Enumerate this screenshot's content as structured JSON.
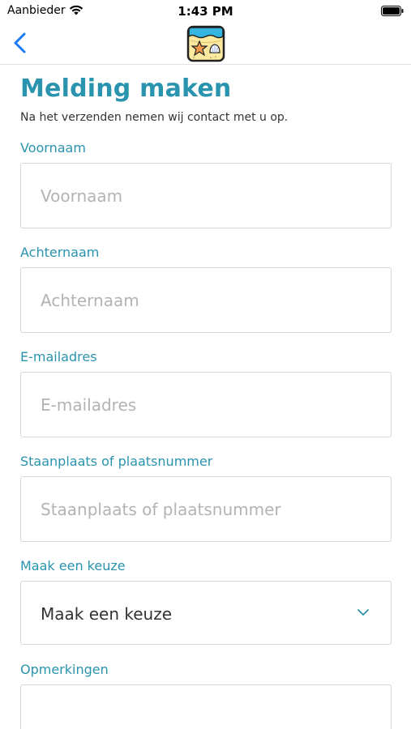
{
  "status_bar": {
    "carrier": "Aanbieder",
    "time": "1:43 PM"
  },
  "nav": {
    "back_icon": "chevron-left-icon",
    "logo_icon": "beach-logo-icon"
  },
  "page": {
    "title": "Melding maken",
    "subtitle": "Na het verzenden nemen wij contact met u op."
  },
  "form": {
    "first_name": {
      "label": "Voornaam",
      "placeholder": "Voornaam",
      "value": ""
    },
    "last_name": {
      "label": "Achternaam",
      "placeholder": "Achternaam",
      "value": ""
    },
    "email": {
      "label": "E-mailadres",
      "placeholder": "E-mailadres",
      "value": ""
    },
    "pitch": {
      "label": "Staanplaats of plaatsnummer",
      "placeholder": "Staanplaats of plaatsnummer",
      "value": ""
    },
    "choice": {
      "label": "Maak een keuze",
      "selected": "Maak een keuze",
      "icon": "chevron-down-icon"
    },
    "remarks": {
      "label": "Opmerkingen"
    }
  },
  "colors": {
    "accent": "#2a93ad",
    "back_blue": "#1a7cf5",
    "border": "#d7d7d7"
  }
}
